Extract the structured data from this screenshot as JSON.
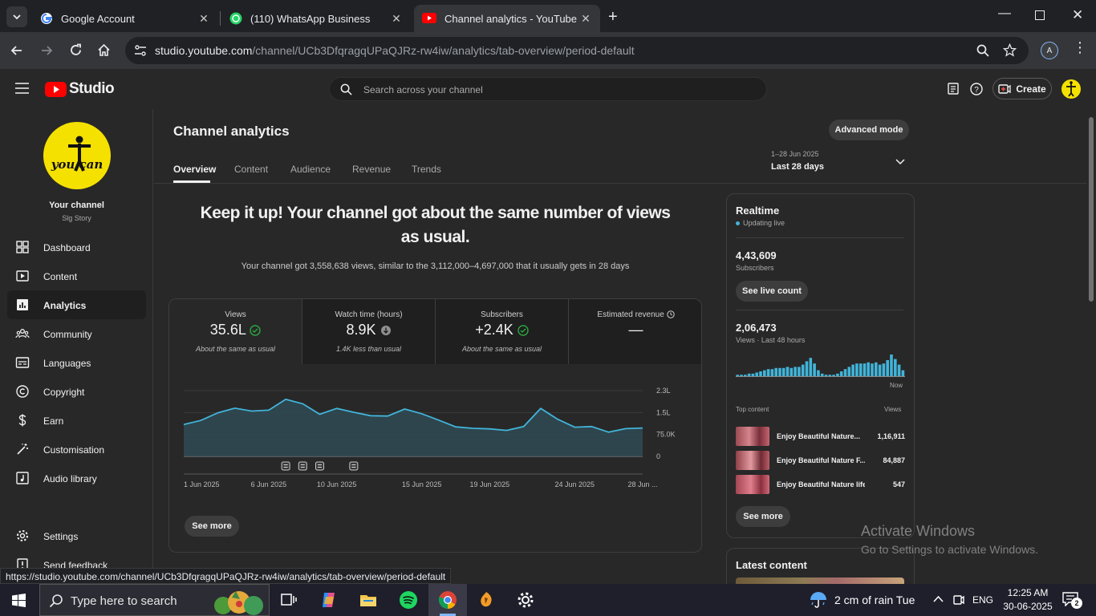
{
  "browser": {
    "tabs": [
      {
        "title": "Google Account"
      },
      {
        "title": "(110) WhatsApp Business"
      },
      {
        "title": "Channel analytics - YouTube Stu"
      }
    ],
    "url_host": "studio.youtube.com",
    "url_path": "/channel/UCb3DfqragqUPaQJRz-rw4iw/analytics/tab-overview/period-default",
    "profile_initial": "A",
    "status_url": "https://studio.youtube.com/channel/UCb3DfqragqUPaQJRz-rw4iw/analytics/tab-overview/period-default"
  },
  "studio": {
    "logo_text": "Studio",
    "search_placeholder": "Search across your channel",
    "create_label": "Create"
  },
  "channel": {
    "avatar_text": "you can",
    "label": "Your channel",
    "name": "Slg Story"
  },
  "sidebar": {
    "items": [
      {
        "label": "Dashboard",
        "icon": "dashboard-icon"
      },
      {
        "label": "Content",
        "icon": "content-icon"
      },
      {
        "label": "Analytics",
        "icon": "analytics-icon"
      },
      {
        "label": "Community",
        "icon": "community-icon"
      },
      {
        "label": "Languages",
        "icon": "languages-icon"
      },
      {
        "label": "Copyright",
        "icon": "copyright-icon"
      },
      {
        "label": "Earn",
        "icon": "earn-icon"
      },
      {
        "label": "Customisation",
        "icon": "customisation-icon"
      },
      {
        "label": "Audio library",
        "icon": "audio-library-icon"
      }
    ],
    "settings_label": "Settings",
    "feedback_label": "Send feedback"
  },
  "page": {
    "title": "Channel analytics",
    "advanced_mode": "Advanced mode",
    "tabs": [
      "Overview",
      "Content",
      "Audience",
      "Revenue",
      "Trends"
    ],
    "date_range": "1–28 Jun 2025",
    "period_label": "Last 28 days",
    "headline_1": "Keep it up! Your channel got about the same number of views",
    "headline_2": "as usual.",
    "subtext": "Your channel got 3,558,638 views, similar to the 3,112,000–4,697,000 that it usually gets in 28 days",
    "see_more": "See more"
  },
  "metrics": [
    {
      "title": "Views",
      "value": "35.6L",
      "sub": "About the same as usual",
      "status": "check"
    },
    {
      "title": "Watch time (hours)",
      "value": "8.9K",
      "sub": "1.4K less than usual",
      "status": "down"
    },
    {
      "title": "Subscribers",
      "value": "+2.4K",
      "sub": "About the same as usual",
      "status": "check"
    },
    {
      "title": "Estimated revenue",
      "value": "—",
      "sub": "",
      "status": "clock"
    }
  ],
  "chart_data": {
    "type": "area",
    "title": "",
    "x": [
      "1 Jun",
      "2 Jun",
      "3 Jun",
      "4 Jun",
      "5 Jun",
      "6 Jun",
      "7 Jun",
      "8 Jun",
      "9 Jun",
      "10 Jun",
      "11 Jun",
      "12 Jun",
      "13 Jun",
      "14 Jun",
      "15 Jun",
      "16 Jun",
      "17 Jun",
      "18 Jun",
      "19 Jun",
      "20 Jun",
      "21 Jun",
      "22 Jun",
      "23 Jun",
      "24 Jun",
      "25 Jun",
      "26 Jun",
      "27 Jun",
      "28 Jun"
    ],
    "values": [
      1090000,
      1230000,
      1490000,
      1650000,
      1550000,
      1580000,
      1950000,
      1800000,
      1440000,
      1640000,
      1510000,
      1390000,
      1380000,
      1620000,
      1460000,
      1240000,
      1010000,
      960000,
      940000,
      890000,
      1020000,
      1640000,
      1270000,
      1000000,
      1020000,
      830000,
      950000,
      970000
    ],
    "x_tick_labels": [
      "1 Jun 2025",
      "6 Jun 2025",
      "10 Jun 2025",
      "15 Jun 2025",
      "19 Jun 2025",
      "24 Jun 2025",
      "28 Jun ..."
    ],
    "x_tick_index": [
      0,
      5,
      9,
      14,
      18,
      23,
      27
    ],
    "y_ticks": [
      0,
      750000,
      1500000,
      2250000
    ],
    "y_tick_labels": [
      "0",
      "75.0K",
      "1.5L",
      "2.3L"
    ],
    "ylim": [
      0,
      2250000
    ],
    "marker_days": [
      6,
      7,
      8,
      10
    ],
    "grid": true,
    "color": "#41b4d9"
  },
  "realtime": {
    "title": "Realtime",
    "status": "Updating live",
    "subscribers": "4,43,609",
    "subscribers_label": "Subscribers",
    "see_live_count": "See live count",
    "views": "2,06,473",
    "views_label": "Views · Last 48 hours",
    "now_label": "Now",
    "bars": [
      2,
      2,
      2,
      3,
      3,
      4,
      5,
      6,
      7,
      7,
      8,
      8,
      8,
      9,
      8,
      9,
      9,
      11,
      14,
      17,
      12,
      6,
      3,
      2,
      2,
      2,
      3,
      5,
      7,
      9,
      11,
      12,
      12,
      12,
      13,
      12,
      13,
      11,
      12,
      15,
      20,
      16,
      11,
      6
    ],
    "top_content_label": "Top content",
    "views_col_label": "Views",
    "top_content": [
      {
        "title": "Enjoy Beautiful Nature...",
        "views": "1,16,911"
      },
      {
        "title": "Enjoy Beautiful Nature F...",
        "views": "84,887"
      },
      {
        "title": "Enjoy Beautiful Nature life ...",
        "views": "547"
      }
    ],
    "see_more": "See more"
  },
  "latest_content": {
    "title": "Latest content"
  },
  "watermark": {
    "line1": "Activate Windows",
    "line2": "Go to Settings to activate Windows."
  },
  "taskbar": {
    "search_placeholder": "Type here to search",
    "weather": "2 cm of rain Tue",
    "language": "ENG",
    "time": "12:25 AM",
    "date": "30-06-2025",
    "notification_count": "2"
  }
}
